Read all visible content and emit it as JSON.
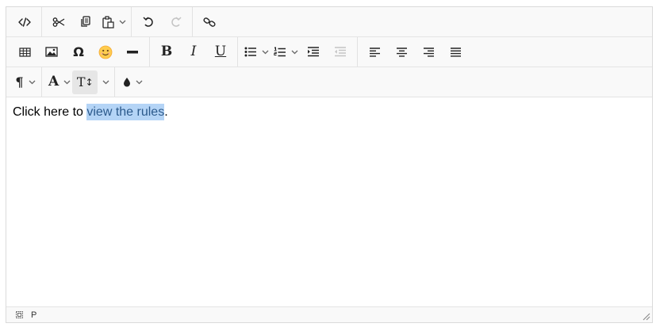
{
  "toolbar": {
    "row1": [
      {
        "name": "source-code-button",
        "icon": "code-icon"
      },
      {
        "name": "cut-button",
        "icon": "scissors-icon"
      },
      {
        "name": "copy-button",
        "icon": "copy-icon"
      },
      {
        "name": "paste-button",
        "icon": "clipboard-icon"
      },
      {
        "name": "undo-button",
        "icon": "undo-icon"
      },
      {
        "name": "redo-button",
        "icon": "redo-icon",
        "disabled": true
      },
      {
        "name": "link-button",
        "icon": "link-icon"
      }
    ],
    "row2": [
      {
        "name": "table-button",
        "icon": "table-icon"
      },
      {
        "name": "image-button",
        "icon": "image-icon"
      },
      {
        "name": "special-char-button",
        "label": "Ω"
      },
      {
        "name": "emoji-button",
        "label": "😊"
      },
      {
        "name": "horizontal-rule-button",
        "icon": "minus-icon"
      },
      {
        "name": "bold-button",
        "label": "B"
      },
      {
        "name": "italic-button",
        "label": "I"
      },
      {
        "name": "underline-button",
        "label": "U"
      },
      {
        "name": "bullet-list-button",
        "icon": "bullet-list-icon"
      },
      {
        "name": "numbered-list-button",
        "icon": "numbered-list-icon"
      },
      {
        "name": "indent-button",
        "icon": "indent-icon"
      },
      {
        "name": "outdent-button",
        "icon": "outdent-icon",
        "disabled": true
      },
      {
        "name": "align-left-button",
        "icon": "align-left-icon"
      },
      {
        "name": "align-center-button",
        "icon": "align-center-icon"
      },
      {
        "name": "align-right-button",
        "icon": "align-right-icon"
      },
      {
        "name": "align-justify-button",
        "icon": "align-justify-icon"
      }
    ],
    "row3": [
      {
        "name": "paragraph-format-button",
        "label": "¶"
      },
      {
        "name": "font-family-button",
        "label": "A"
      },
      {
        "name": "font-size-button",
        "label": "T↕",
        "active": true
      },
      {
        "name": "text-color-button",
        "icon": "droplet-icon"
      }
    ],
    "labels": {
      "omega": "Ω",
      "emoji": "😊",
      "bold": "B",
      "italic": "I",
      "underline": "U",
      "paragraph": "¶",
      "font": "A",
      "size_t": "T",
      "size_arrow": "↕"
    }
  },
  "content": {
    "text_before": "Click here to ",
    "link_text": "view the rules",
    "text_after": "."
  },
  "statusbar": {
    "path": "P"
  },
  "colors": {
    "selection": "#b4d4f6",
    "link": "#2c5a8c",
    "toolbar_bg": "#f9f9f9",
    "border": "#dadada"
  }
}
